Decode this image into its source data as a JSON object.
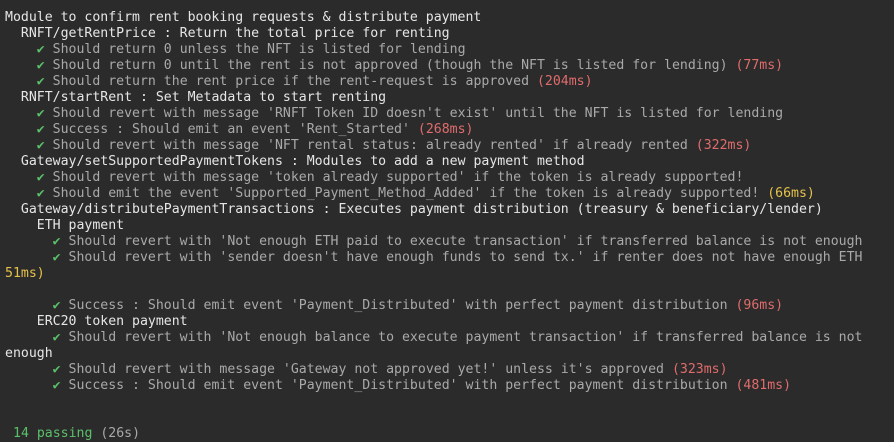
{
  "lines": [
    {
      "indent": "",
      "text": "Module to confirm rent booking requests & distribute payment"
    },
    {
      "indent": "  ",
      "text": "RNFT/getRentPrice : Return the total price for renting"
    },
    {
      "indent": "    ",
      "check": "✔",
      "text": " Should return 0 unless the NFT is listed for lending"
    },
    {
      "indent": "    ",
      "check": "✔",
      "text": " Should return 0 until the rent is not approved (though the NFT is listed for lending) ",
      "time": "(77ms)",
      "tclass": "slow"
    },
    {
      "indent": "    ",
      "check": "✔",
      "text": " Should return the rent price if the rent-request is approved ",
      "time": "(204ms)",
      "tclass": "slow"
    },
    {
      "indent": "  ",
      "text": "RNFT/startRent : Set Metadata to start renting"
    },
    {
      "indent": "    ",
      "check": "✔",
      "text": " Should revert with message 'RNFT Token ID doesn't exist' until the NFT is listed for lending"
    },
    {
      "indent": "    ",
      "check": "✔",
      "text": " Success : Should emit an event 'Rent_Started' ",
      "time": "(268ms)",
      "tclass": "slow"
    },
    {
      "indent": "    ",
      "check": "✔",
      "text": " Should revert with message 'NFT rental status: already rented' if already rented ",
      "time": "(322ms)",
      "tclass": "slow"
    },
    {
      "indent": "  ",
      "text": "Gateway/setSupportedPaymentTokens : Modules to add a new payment method"
    },
    {
      "indent": "    ",
      "check": "✔",
      "text": " Should revert with message 'token already supported' if the token is already supported!"
    },
    {
      "indent": "    ",
      "check": "✔",
      "text": " Should emit the event 'Supported_Payment_Method_Added' if the token is already supported! ",
      "time": "(66ms)",
      "tclass": "med"
    },
    {
      "indent": "  ",
      "text": "Gateway/distributePaymentTransactions : Executes payment distribution (treasury & beneficiary/lender)"
    },
    {
      "indent": "    ",
      "text": "ETH payment"
    },
    {
      "indent": "      ",
      "check": "✔",
      "text": " Should revert with 'Not enough ETH paid to execute transaction' if transferred balance is not enough"
    },
    {
      "indent": "      ",
      "check": "✔",
      "text": " Should revert with 'sender doesn't have enough funds to send tx.' if renter does not have enough ETH"
    },
    {
      "indent": "",
      "time": "51ms)",
      "tclass": "med",
      "text": ""
    },
    {
      "indent": "",
      "text": ""
    },
    {
      "indent": "      ",
      "check": "✔",
      "text": " Success : Should emit event 'Payment_Distributed' with perfect payment distribution ",
      "time": "(96ms)",
      "tclass": "slow"
    },
    {
      "indent": "    ",
      "text": "ERC20 token payment"
    },
    {
      "indent": "      ",
      "check": "✔",
      "text": " Should revert with 'Not enough balance to execute payment transaction' if transferred balance is not"
    },
    {
      "indent": "",
      "text": "enough"
    },
    {
      "indent": "      ",
      "check": "✔",
      "text": " Should revert with message 'Gateway not approved yet!' unless it's approved ",
      "time": "(323ms)",
      "tclass": "slow"
    },
    {
      "indent": "      ",
      "check": "✔",
      "text": " Success : Should emit event 'Payment_Distributed' with perfect payment distribution ",
      "time": "(481ms)",
      "tclass": "slow"
    },
    {
      "indent": "",
      "text": ""
    },
    {
      "indent": "",
      "text": ""
    }
  ],
  "summary": {
    "passing": "14 passing",
    "duration": "(26s)"
  },
  "colors": {
    "background": "#2b2b2b",
    "check": "#5bc06a",
    "slow": "#e06c6c",
    "medium": "#e5c24a"
  }
}
